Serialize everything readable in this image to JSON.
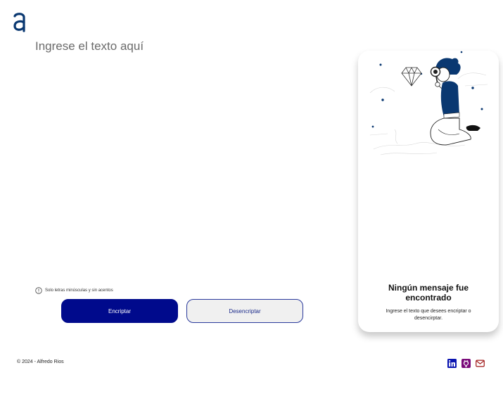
{
  "header": {
    "logo_icon": "alura-a-logo-icon"
  },
  "editor": {
    "placeholder": "Ingrese el texto aquí"
  },
  "hint": {
    "icon": "info-icon",
    "text": "Solo letras minúsculas y sin acentos"
  },
  "actions": {
    "encrypt_label": "Encriptar",
    "decrypt_label": "Desencriptar"
  },
  "result_panel": {
    "illustration": "person-with-magnifier-icon",
    "title": "Ningún mensaje fue encontrado",
    "subtitle": "Ingrese el texto que desees encriptar o desencirptar."
  },
  "footer": {
    "copyright": "© 2024 - Alfredo Rios",
    "social_icons": [
      "linkedin-icon",
      "github-icon",
      "mail-icon"
    ]
  },
  "colors": {
    "primary": "#000a8c",
    "logo": "#0a3871",
    "secondary_bg": "#f0f0f0",
    "linkedin": "#0a14b0",
    "github": "#7a0a7a",
    "mail": "#a01818"
  }
}
